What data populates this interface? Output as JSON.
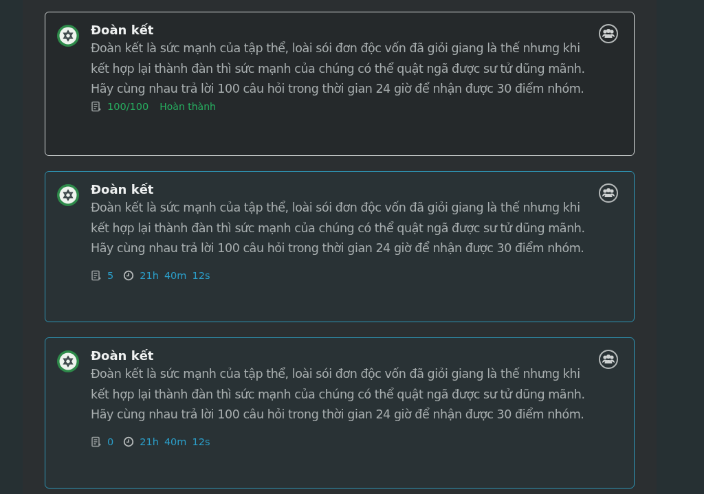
{
  "challenges": [
    {
      "kind": "completed",
      "title": "Đoàn kết",
      "description": "Đoàn kết là sức mạnh của tập thể, loài sói đơn độc vốn đã giỏi giang là thế nhưng khi kết hợp lại thành đàn thì sức mạnh của chúng có thể quật ngã được sư tử dũng mãnh. Hãy cùng nhau trả lời 100 câu hỏi trong thời gian 24 giờ để nhận được 30 điểm nhóm.",
      "count": "100/100",
      "status": "Hoàn thành"
    },
    {
      "kind": "active",
      "title": "Đoàn kết",
      "description": "Đoàn kết là sức mạnh của tập thể, loài sói đơn độc vốn đã giỏi giang là thế nhưng khi kết hợp lại thành đàn thì sức mạnh của chúng có thể quật ngã được sư tử dũng mãnh. Hãy cùng nhau trả lời 100 câu hỏi trong thời gian 24 giờ để nhận được 30 điểm nhóm.",
      "count": "5",
      "timer": [
        "21h",
        "40m",
        "12s"
      ]
    },
    {
      "kind": "active",
      "title": "Đoàn kết",
      "description": "Đoàn kết là sức mạnh của tập thể, loài sói đơn độc vốn đã giỏi giang là thế nhưng khi kết hợp lại thành đàn thì sức mạnh của chúng có thể quật ngã được sư tử dũng mãnh. Hãy cùng nhau trả lời 100 câu hỏi trong thời gian 24 giờ để nhận được 30 điểm nhóm.",
      "count": "0",
      "timer": [
        "21h",
        "40m",
        "12s"
      ]
    }
  ]
}
